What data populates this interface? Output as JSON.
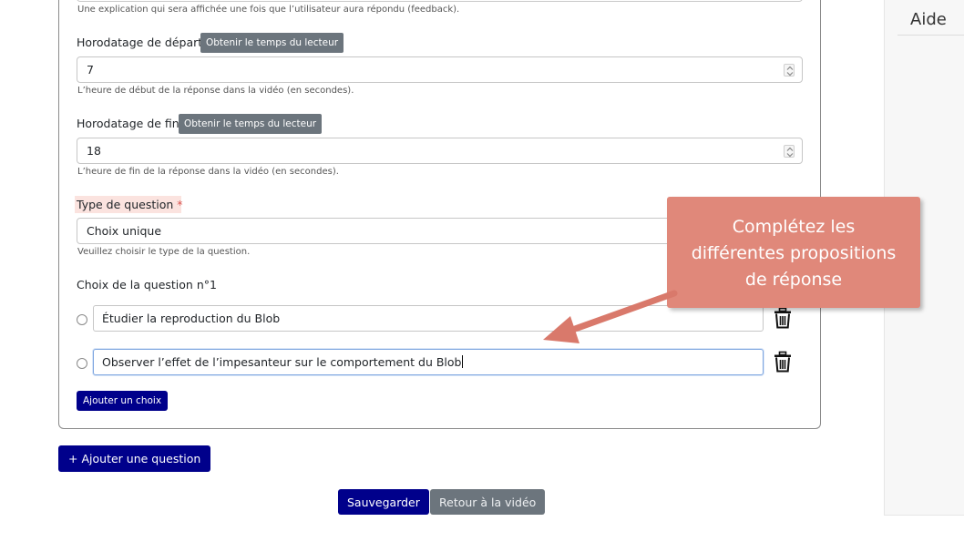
{
  "form": {
    "feedback_help": "Une explication qui sera affichée une fois que l’utilisateur aura répondu (feedback).",
    "start": {
      "label": "Horodatage de départ",
      "button": "Obtenir le temps du lecteur",
      "value": "7",
      "help": "L’heure de début de la réponse dans la vidéo (en secondes)."
    },
    "end": {
      "label": "Horodatage de fin",
      "button": "Obtenir le temps du lecteur",
      "value": "18",
      "help": "L’heure de fin de la réponse dans la vidéo (en secondes)."
    },
    "question_type": {
      "label": "Type de question",
      "required_mark": "*",
      "value": "Choix unique",
      "help": "Veuillez choisir le type de la question."
    },
    "choices": {
      "title": "Choix de la question n°1",
      "items": [
        {
          "text": "Étudier la reproduction du Blob"
        },
        {
          "text": "Observer l’effet de l’impesanteur sur le comportement du Blob"
        }
      ],
      "add_choice_label": "Ajouter un choix"
    }
  },
  "actions": {
    "add_question_icon": "+",
    "add_question_label": "Ajouter une question",
    "save_label": "Sauvegarder",
    "back_label": "Retour à la vidéo"
  },
  "sidebar": {
    "title": "Aide"
  },
  "callout": {
    "lines": [
      "Complétez les",
      "différentes propositions",
      "de réponse"
    ]
  },
  "colors": {
    "primary": "#00008b",
    "secondary": "#6c757d",
    "callout": "#e0887a",
    "required": "#d9534f"
  }
}
